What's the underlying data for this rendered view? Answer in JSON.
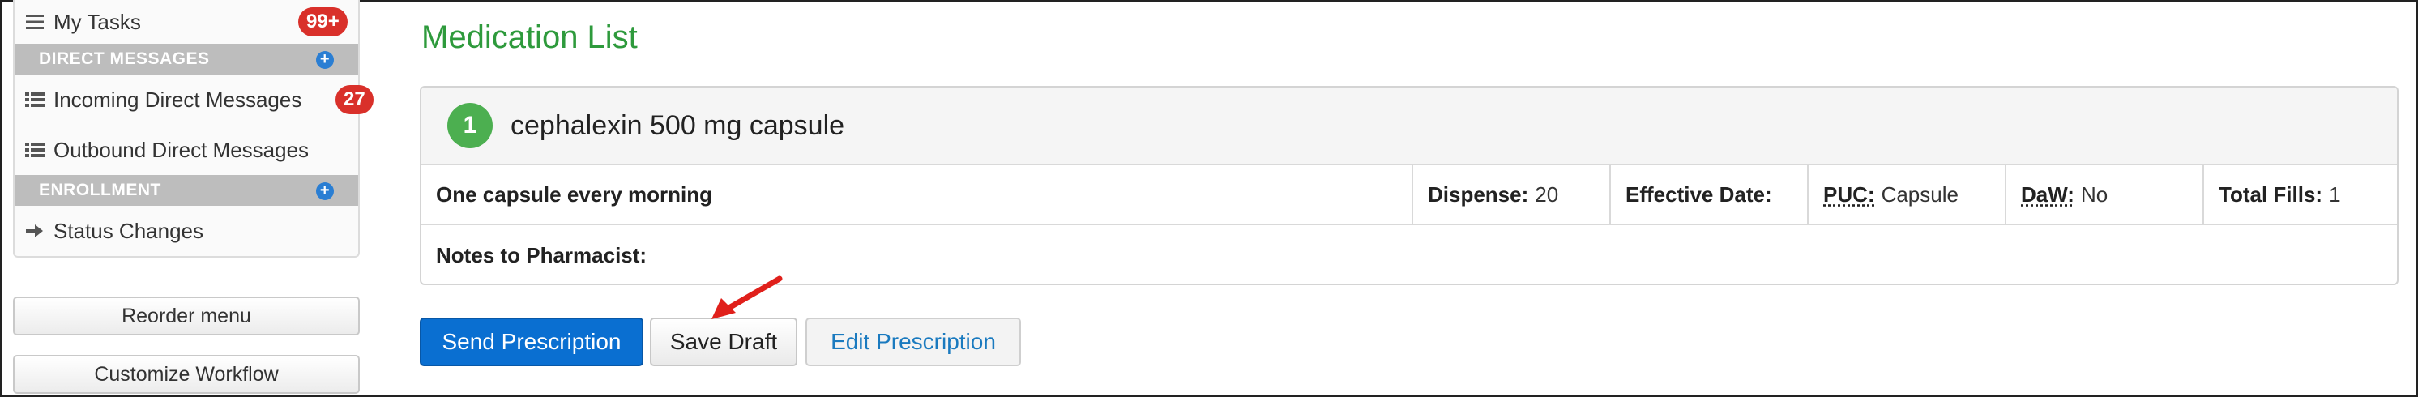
{
  "sidebar": {
    "my_tasks": {
      "label": "My Tasks",
      "badge": "99+",
      "icon": "list-icon"
    },
    "direct_messages": {
      "header": "DIRECT MESSAGES",
      "items": [
        {
          "label": "Incoming Direct Messages",
          "badge": "27",
          "icon": "table-list-icon"
        },
        {
          "label": "Outbound Direct Messages",
          "icon": "table-list-icon"
        }
      ]
    },
    "enrollment": {
      "header": "ENROLLMENT",
      "items": [
        {
          "label": "Status Changes",
          "icon": "arrow-right-icon"
        }
      ]
    },
    "reorder_menu": "Reorder menu",
    "customize_workflow": "Customize Workflow"
  },
  "main": {
    "title": "Medication List",
    "medication": {
      "number": "1",
      "name": "cephalexin 500 mg capsule",
      "sig": "One capsule every morning",
      "dispense_label": "Dispense:",
      "dispense_value": "20",
      "effective_date_label": "Effective Date:",
      "effective_date_value": "",
      "puc_label": "PUC:",
      "puc_value": "Capsule",
      "daw_label": "DaW:",
      "daw_value": "No",
      "total_fills_label": "Total Fills:",
      "total_fills_value": "1",
      "notes_label": "Notes to Pharmacist:"
    },
    "actions": {
      "send": "Send Prescription",
      "save_draft": "Save Draft",
      "edit": "Edit Prescription"
    }
  },
  "colors": {
    "title_green": "#2e9a3c",
    "primary_blue": "#0a6fd1",
    "badge_red": "#d9302a",
    "number_green": "#4caf50",
    "link_blue": "#1a7abf",
    "annotation_red": "#e0201b"
  }
}
